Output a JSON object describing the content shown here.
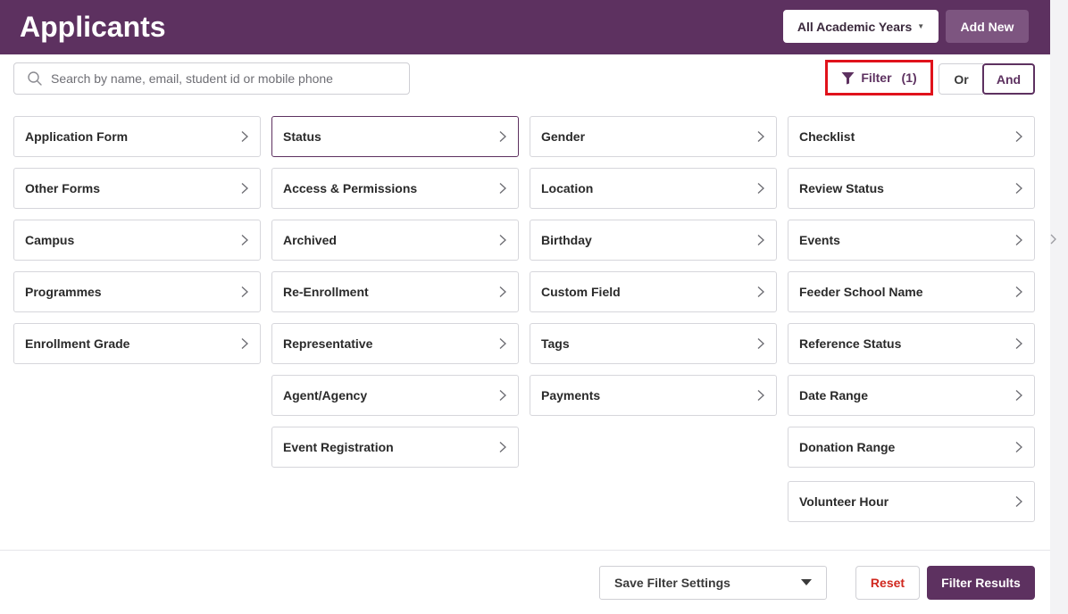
{
  "header": {
    "title": "Applicants",
    "year_selector": "All Academic Years",
    "add_new": "Add New"
  },
  "toolbar": {
    "search_placeholder": "Search by name, email, student id or mobile phone",
    "filter_label": "Filter",
    "filter_count": "(1)",
    "or_label": "Or",
    "and_label": "And",
    "and_selected": true
  },
  "filters": {
    "col1": [
      "Application Form",
      "Other Forms",
      "Campus",
      "Programmes",
      "Enrollment Grade"
    ],
    "col2": [
      "Status",
      "Access & Permissions",
      "Archived",
      "Re-Enrollment",
      "Representative",
      "Agent/Agency",
      "Event Registration"
    ],
    "col3": [
      "Gender",
      "Location",
      "Birthday",
      "Custom Field",
      "Tags",
      "Payments"
    ],
    "col4": [
      "Checklist",
      "Review Status",
      "Events",
      "Feeder School Name",
      "Reference Status",
      "Date Range",
      "Donation Range",
      "Volunteer Hour"
    ],
    "active": "Status"
  },
  "footer": {
    "save_settings": "Save Filter Settings",
    "reset": "Reset",
    "filter_results": "Filter Results"
  },
  "colors": {
    "brand": "#5d3160",
    "highlight": "#e0121b",
    "reset": "#d0281f"
  },
  "icons": [
    "search-icon",
    "funnel-icon",
    "chevron-right-icon",
    "caret-down-icon"
  ]
}
